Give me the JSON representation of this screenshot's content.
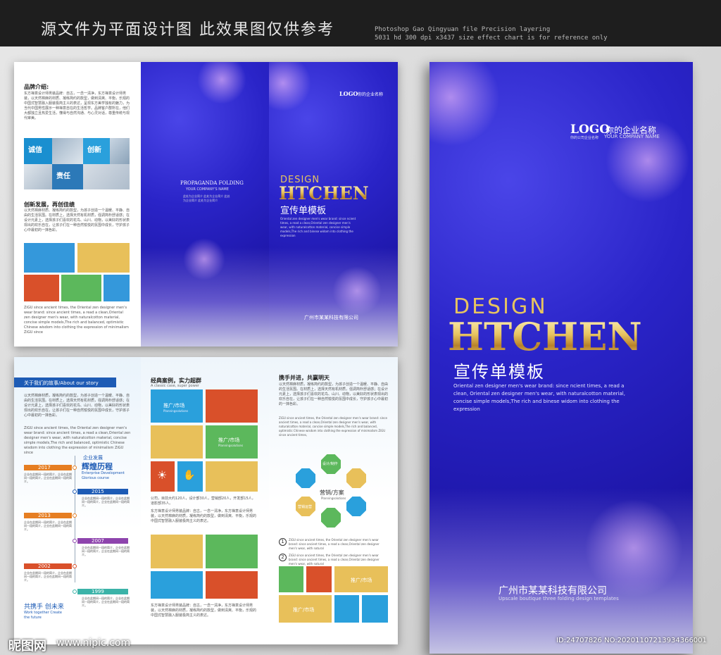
{
  "header": {
    "title_cn": "源文件为平面设计图 此效果图仅供参考",
    "title_en": "Photoshop Gao Qingyuan file Precision layering\n5031 hd 300 dpi x3437 size effect chart is for reference only"
  },
  "panel1": {
    "h1": "品牌介绍:",
    "p1": "东方禅意设计师男装品牌：自古，一念一清净，东方禅意设计师男装，以天然棉麻的材质、凝练简约的款型，做到清爽、平衡，乐观的中国式智慧融入服装极简主义的表达，呈现东方美学独有的魅力，为当代中国男性展示一种禅意自在的生活哲学。品牌客户群所在，他们大都独立且热爱生活，懂得与自然沟通、与心灵对话，尊重传统与现代审美。",
    "tags": [
      "诚信",
      "创新",
      "责任"
    ],
    "tag_subs": [
      "HONESTY",
      "INNOVATION",
      "USABILITY"
    ],
    "h2": "创新发展，再创佳绩",
    "p2": "以天然棉麻材质、凝练简约的款型，为孩子创造一个温暖、平静、自由的生活氛围。在材质上，选择天然有机材质，强调简朴舒适感；在设计元素上，选择孩子们喜欢的花鸟、山川、动物，以美好的形状表现出的欢乐自在，让孩子们在一种自然愉悦的氛围中成长，守护孩子心中最初的一抹色彩。",
    "p3": "ZiGU since ancient times, the Oriental zen designer men's wear brand: since ancient times, a read a clean,Oriental zen designer men's wear, with naturalcotton material, concise simple models,The rich and balanced, optimistic Chinese wisdom into clothing the expression of minimalism ZiGU since"
  },
  "panel2": {
    "title": "PROPAGANDA FOLDING",
    "sub": "YOUR COMPANY'S NAME",
    "small": "此处为企业简介 此处为企业简介 此处为企业简介 此处为企业简介"
  },
  "panel3": {
    "logo": "LOGO",
    "logo_cn": "你的企业名称",
    "design": "DESIGN",
    "htchen": "HTCHEN",
    "cn": "宣传单模板",
    "desc": "Oriental zen designer men's wear brand: since ncient times, a read a clean,Oriental zen designer men's wear, with naturalcotton material, concise simple models,The rich and binese widom into clothing the expression",
    "company": "广州市某某科技有限公司"
  },
  "cover": {
    "logo": "LOGO",
    "logo_cn": "你的企业名称",
    "logo_sub": "你的公司企业名称",
    "logo_en": "YOUR COMPANY NAME",
    "design": "DESIGN",
    "htchen": "HTCHEN",
    "cn": "宣传单模板",
    "desc": "Oriental zen designer men's wear brand: since ncient times, a read a clean, Oriental zen designer men's wear, with naturalcotton material, concise simple models,The rich and binese widom into clothing the expression",
    "company": "广州市某某科技有限公司",
    "company_en": "Upscale boutique three folding design templates"
  },
  "inner1": {
    "ribbon": "关于我们的故事/About our story",
    "p1": "以天然棉麻材质，凝练简约的款型，为孩子创造一个温暖、平静、自由的生活氛围。在材质上，选择天然有机材质，强调简朴舒适感；在设计元素上，选择孩子们喜欢的花鸟、山川、动物，以美好的形状表现出的欢乐自在，让孩子们在一种自然愉悦的氛围中成长，守护孩子心中最初的一抹色彩。",
    "p2": "ZiGU since ancient times, the Oriental zen designer men's wear brand: since ancient times, a read a clean,Oriental zen designer men's wear, with naturalcotton material, concise simple models,The rich and balanced, optimistic Chinese wisdom into clothing the expression of minimalism ZiGU since",
    "dev_cn": "企业发展",
    "dev_big": "辉煌历程",
    "dev_en": "Enterprise Development Glorious course",
    "years": [
      "2017",
      "2015",
      "2013",
      "2007",
      "2002",
      "1999"
    ],
    "item_text": "企业在此期间一段的简介，企业在此期间一段的简介，企业在此期间一段的简介。",
    "foot_cn": "共携手 创未来",
    "foot_en": "Work together Create the future"
  },
  "inner2": {
    "title": "经典案例，实力超群",
    "sub": "A classic case, super power",
    "cells": [
      "推广/市场",
      "推广/市场"
    ],
    "cell_sub": "Planningsolutions",
    "p1": "公司，目前大约120人，设计部30人，营销部20人，开发部15人，道影部35人。",
    "p2": "东方禅意设计师男装品牌：自古，一念一清净，东方禅意设计师男装，以天然棉麻的材质，凝练简约的款型，做到清爽、平衡，乐观的中国式智慧融入服装极简主义的表达。",
    "p3": "东方禅意设计师男装品牌：自古，一念一清净，东方禅意设计师男装，以天然棉麻的材质，凝练简约的款型，做到清爽、平衡，乐观的中国式智慧融入服装极简主义的表达。"
  },
  "inner3": {
    "title": "携手并进，共赢明天",
    "p1": "以天然棉麻材质，凝练简约的款型，为孩子创造一个温暖、平静、自由的生活氛围。在材质上，选择天然有机材质，强调简朴舒适感；在设计元素上，选择孩子们喜欢的花鸟、山川、动物，以美好的形状表现出的欢乐自在，让孩子们在一种自然愉悦的氛围中成长，守护孩子心中最初的一抹色彩。",
    "p2": "ZiGU since ancient times, the Oriental zen designer men's wear brand: since ancient times, a read a clean,Oriental zen designer men's wear, with naturalcotton material, concise simple models,The rich and balanced, optimistic Chinese wisdom into clothing the expression of minimalism ZiGU since ancient times,",
    "center": "营销/方案",
    "center_sub": "Planningsolutions",
    "oct_top": "设计/制作",
    "oct_left": "营销运营",
    "n1": "1",
    "n2": "2",
    "t1": "ZiGU since ancient times, the Oriental zen designer men's wear brand: since ancient times, a read a clean,Oriental zen designer men's wear, with natural",
    "t2": "ZiGU since ancient times, the Oriental zen designer men's wear brand: since ancient times, a read a clean,Oriental zen designer men's wear, with natural",
    "cells": [
      "推广/市场",
      "推广/市场"
    ]
  },
  "footer": {
    "logo": "昵图网",
    "url": "www.nipic.com",
    "id": "ID:24707826 NO:20201107213934366001"
  },
  "colors": {
    "blue": "#2a24c8",
    "orange": "#e67e22",
    "green": "#5cb85c",
    "sky": "#3498db",
    "yellow": "#e8c05a",
    "red": "#d9502a"
  }
}
